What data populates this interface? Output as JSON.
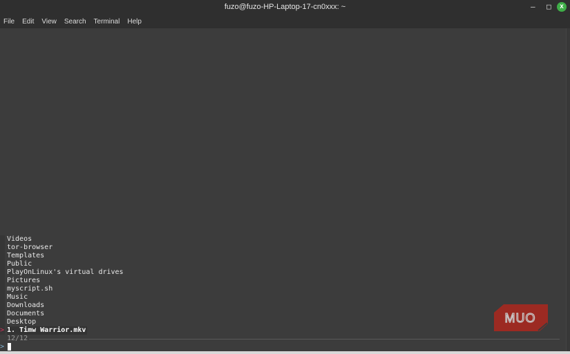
{
  "window": {
    "title": "fuzo@fuzo-HP-Laptop-17-cn0xxx: ~",
    "minimize": "–",
    "maximize": "□",
    "close": "x"
  },
  "menu": [
    "File",
    "Edit",
    "View",
    "Search",
    "Terminal",
    "Help"
  ],
  "fzf": {
    "items": [
      "Videos",
      "tor-browser",
      "Templates",
      "Public",
      "PlayOnLinux's virtual drives",
      "Pictures",
      "myscript.sh",
      "Music",
      "Downloads",
      "Documents",
      "Desktop"
    ],
    "selected": "1. Timw Warrior.mkv",
    "pointer": ">",
    "count": "12/12",
    "prompt": ">"
  },
  "watermark": "MUO",
  "colors": {
    "pointer": "#d0315a",
    "logo": "#9c2a22"
  }
}
